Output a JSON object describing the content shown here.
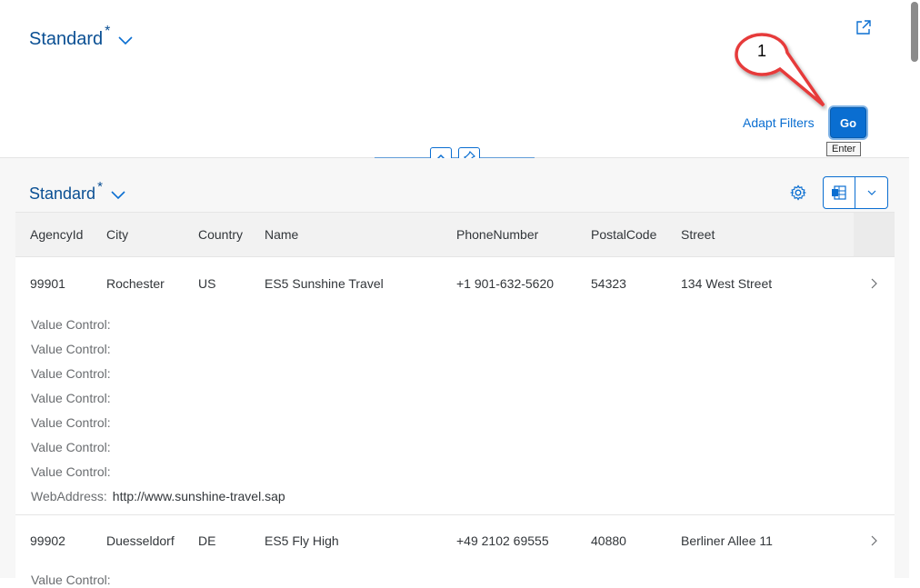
{
  "header": {
    "variant_title": "Standard",
    "variant_modified": "*",
    "adapt_filters_label": "Adapt Filters",
    "go_label": "Go",
    "go_tooltip": "Enter"
  },
  "callout": {
    "number": "1",
    "color": "#e63a3a"
  },
  "table": {
    "title": "Standard",
    "modified": "*",
    "columns": [
      "AgencyId",
      "City",
      "Country",
      "Name",
      "PhoneNumber",
      "PostalCode",
      "Street"
    ],
    "rows": [
      {
        "cells": [
          "99901",
          "Rochester",
          "US",
          "ES5 Sunshine Travel",
          "+1 901-632-5620",
          "54323",
          "134 West Street"
        ],
        "details": [
          {
            "label": "Value Control:",
            "value": ""
          },
          {
            "label": "Value Control:",
            "value": ""
          },
          {
            "label": "Value Control:",
            "value": ""
          },
          {
            "label": "Value Control:",
            "value": ""
          },
          {
            "label": "Value Control:",
            "value": ""
          },
          {
            "label": "Value Control:",
            "value": ""
          },
          {
            "label": "Value Control:",
            "value": ""
          },
          {
            "label": "WebAddress:",
            "value": "http://www.sunshine-travel.sap"
          }
        ]
      },
      {
        "cells": [
          "99902",
          "Duesseldorf",
          "DE",
          "ES5 Fly High",
          "+49 2102 69555",
          "40880",
          "Berliner Allee 11"
        ],
        "details": [
          {
            "label": "Value Control:",
            "value": ""
          }
        ]
      }
    ]
  },
  "colors": {
    "brand": "#0a6ed1",
    "title": "#0a4f93"
  }
}
